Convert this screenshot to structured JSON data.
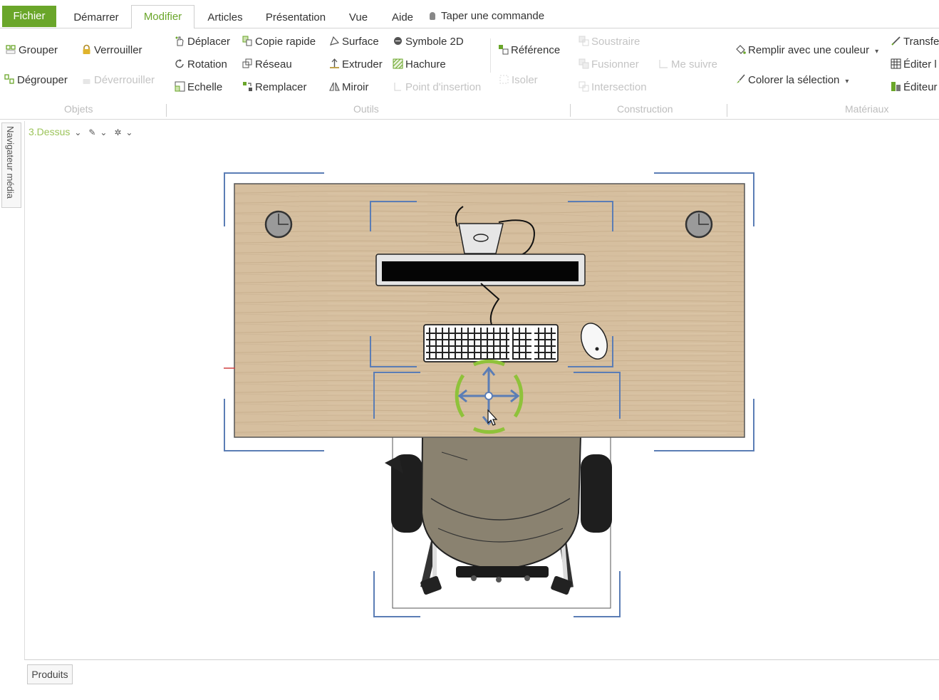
{
  "tabs": [
    {
      "label": "Fichier"
    },
    {
      "label": "Démarrer"
    },
    {
      "label": "Modifier"
    },
    {
      "label": "Articles"
    },
    {
      "label": "Présentation"
    },
    {
      "label": "Vue"
    },
    {
      "label": "Aide"
    }
  ],
  "command_prompt": "Taper une commande",
  "ribbon": {
    "objets": {
      "label": "Objets",
      "grouper": "Grouper",
      "degrouper": "Dégrouper",
      "verrouiller": "Verrouiller",
      "deverrouiller": "Déverrouiller"
    },
    "outils": {
      "label": "Outils",
      "deplacer": "Déplacer",
      "rotation": "Rotation",
      "echelle": "Echelle",
      "copie_rapide": "Copie rapide",
      "reseau": "Réseau",
      "remplacer": "Remplacer",
      "surface": "Surface",
      "extruder": "Extruder",
      "miroir": "Miroir",
      "symbole_2d": "Symbole 2D",
      "hachure": "Hachure",
      "point_insertion": "Point d'insertion"
    },
    "construction": {
      "label": "Construction",
      "reference": "Référence",
      "isoler": "Isoler",
      "soustraire": "Soustraire",
      "fusionner": "Fusionner",
      "intersection": "Intersection",
      "me_suivre": "Me suivre"
    },
    "materiaux": {
      "label": "Matériaux",
      "remplir": "Remplir avec une couleur",
      "colorer": "Colorer la sélection",
      "transferer": "Transfer",
      "editer": "Éditer l",
      "editeur": "Éditeur"
    }
  },
  "side_panel": {
    "label": "Navigateur média"
  },
  "view": {
    "name": "3.Dessus"
  },
  "bottom": {
    "produits": "Produits"
  },
  "colors": {
    "accent": "#6aa62a",
    "desk": "#d6bf9f",
    "chair": "#8a8270",
    "selection": "#5b7db5",
    "gizmo_ring": "#8fc23a"
  }
}
